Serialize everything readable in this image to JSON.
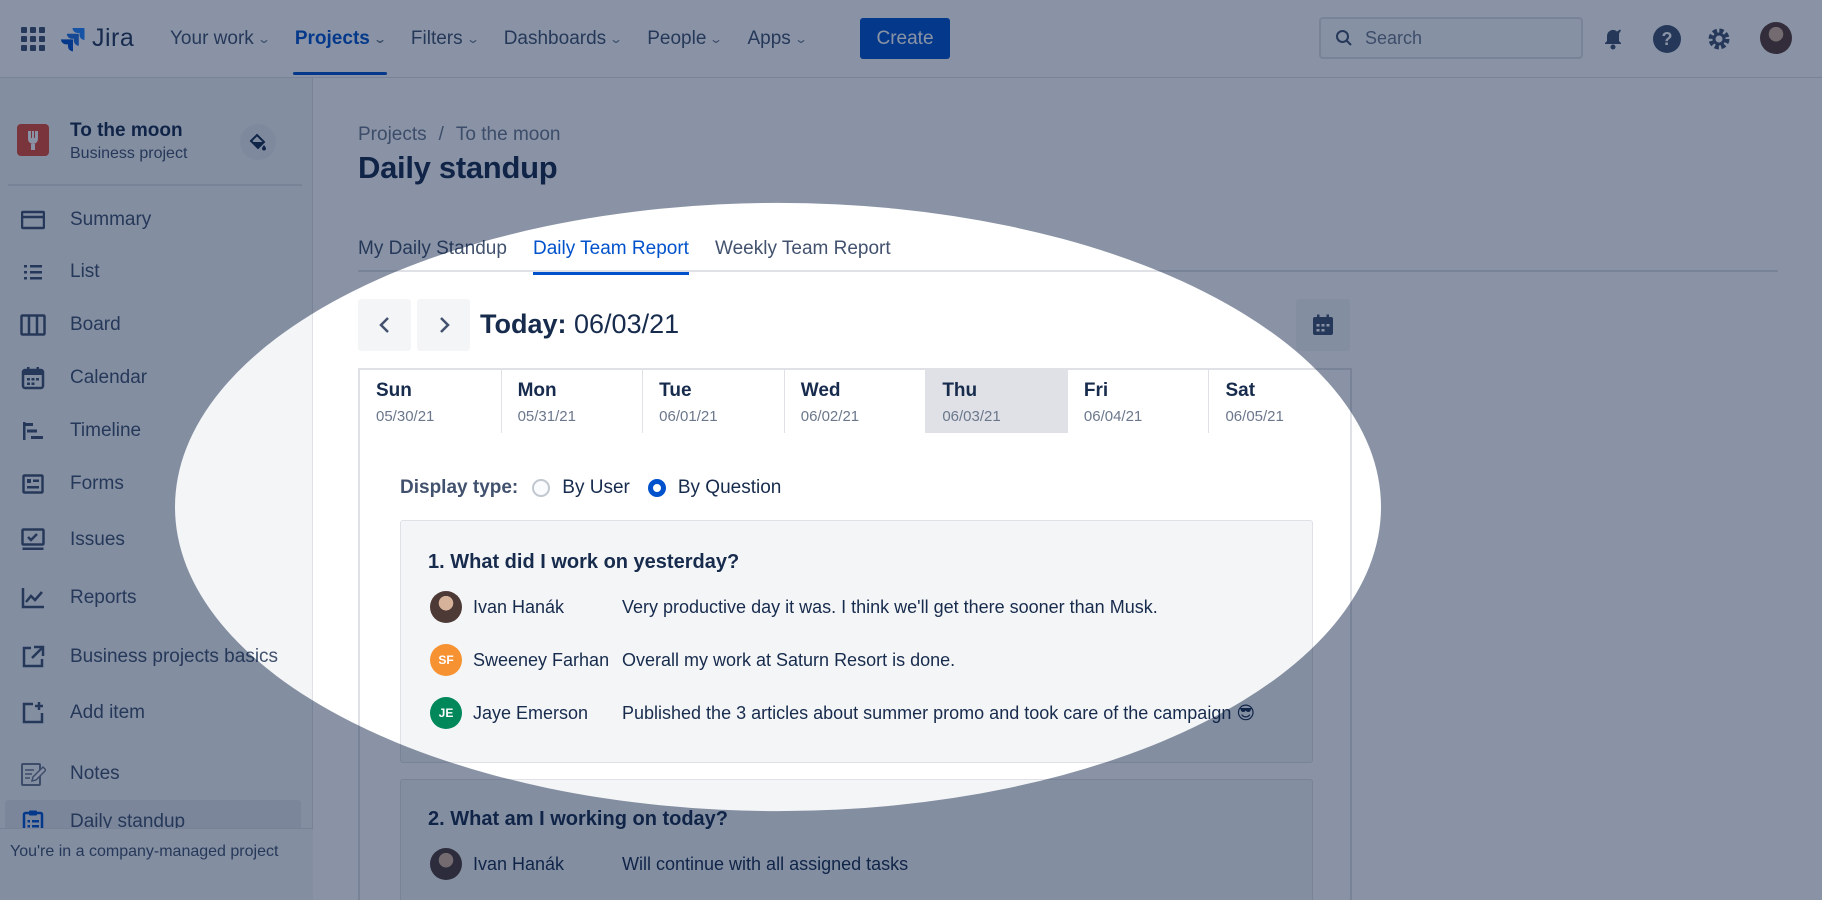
{
  "topnav": {
    "logo_text": "Jira",
    "items": [
      {
        "label": "Your work",
        "active": false
      },
      {
        "label": "Projects",
        "active": true
      },
      {
        "label": "Filters",
        "active": false
      },
      {
        "label": "Dashboards",
        "active": false
      },
      {
        "label": "People",
        "active": false
      },
      {
        "label": "Apps",
        "active": false
      }
    ],
    "create_label": "Create",
    "search_placeholder": "Search"
  },
  "sidebar": {
    "project_name": "To the moon",
    "project_type": "Business project",
    "items": [
      {
        "label": "Summary",
        "icon": "summary-icon"
      },
      {
        "label": "List",
        "icon": "list-icon"
      },
      {
        "label": "Board",
        "icon": "board-icon"
      },
      {
        "label": "Calendar",
        "icon": "calendar-icon"
      },
      {
        "label": "Timeline",
        "icon": "timeline-icon"
      },
      {
        "label": "Forms",
        "icon": "forms-icon"
      },
      {
        "label": "Issues",
        "icon": "issues-icon"
      },
      {
        "label": "Reports",
        "icon": "reports-icon"
      },
      {
        "label": "Business projects basics",
        "icon": "external-link-icon"
      },
      {
        "label": "Add item",
        "icon": "add-item-icon"
      },
      {
        "label": "Notes",
        "icon": "notes-icon"
      },
      {
        "label": "Daily standup",
        "icon": "clipboard-icon",
        "active": true
      }
    ],
    "footer": "You're in a company-managed project"
  },
  "main": {
    "breadcrumb": [
      "Projects",
      "/",
      "To the moon"
    ],
    "title": "Daily standup",
    "tabs": [
      {
        "label": "My Daily Standup",
        "active": false
      },
      {
        "label": "Daily Team Report",
        "active": true
      },
      {
        "label": "Weekly Team Report",
        "active": false
      }
    ],
    "today_label": "Today:",
    "today_date": "06/03/21",
    "week": [
      {
        "day": "Sun",
        "date": "05/30/21"
      },
      {
        "day": "Mon",
        "date": "05/31/21"
      },
      {
        "day": "Tue",
        "date": "06/01/21"
      },
      {
        "day": "Wed",
        "date": "06/02/21"
      },
      {
        "day": "Thu",
        "date": "06/03/21",
        "selected": true
      },
      {
        "day": "Fri",
        "date": "06/04/21"
      },
      {
        "day": "Sat",
        "date": "06/05/21"
      }
    ],
    "display_type": {
      "label": "Display type:",
      "options": [
        {
          "label": "By User",
          "checked": false
        },
        {
          "label": "By Question",
          "checked": true
        }
      ]
    },
    "questions": [
      {
        "title": "1. What did I work on yesterday?",
        "answers": [
          {
            "name": "Ivan Hanák",
            "initials": "",
            "color": "#8a6a5c",
            "text": "Very productive day it was. I think we'll get there sooner than Musk."
          },
          {
            "name": "Sweeney Farhan",
            "initials": "SF",
            "color": "#f79232",
            "text": "Overall my work at Saturn Resort is done."
          },
          {
            "name": "Jaye Emerson",
            "initials": "JE",
            "color": "#00875a",
            "text": "Published the 3 articles about summer promo and took care of the campaign 😎"
          }
        ]
      },
      {
        "title": "2. What am I working on today?",
        "answers": [
          {
            "name": "Ivan Hanák",
            "initials": "",
            "color": "#8a6a5c",
            "text": "Will continue with all assigned tasks"
          }
        ]
      }
    ]
  }
}
